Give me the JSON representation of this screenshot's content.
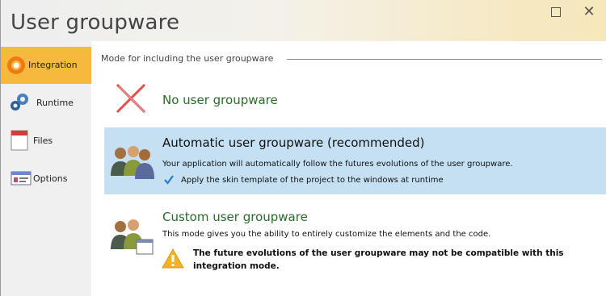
{
  "window": {
    "title": "User groupware",
    "maximize_icon": "maximize-icon",
    "close_icon": "close-icon"
  },
  "sidebar": {
    "items": [
      {
        "label": "Integration",
        "icon": "integration-icon",
        "active": true
      },
      {
        "label": "Runtime",
        "icon": "gears-icon",
        "active": false
      },
      {
        "label": "Files",
        "icon": "file-icon",
        "active": false
      },
      {
        "label": "Options",
        "icon": "options-icon",
        "active": false
      }
    ]
  },
  "content": {
    "section_title": "Mode for including the user groupware",
    "options": [
      {
        "title": "No user groupware",
        "icon": "red-x-icon",
        "selected": false
      },
      {
        "title": "Automatic user groupware (recommended)",
        "description": "Your application will automatically follow the futures evolutions of the user groupware.",
        "checkbox_label": "Apply the skin template of the project to the windows at runtime",
        "checkbox_checked": true,
        "icon": "users-icon",
        "selected": true
      },
      {
        "title": "Custom user groupware",
        "description": "This mode gives you the ability to entirely customize the elements and the code.",
        "warning": "The future evolutions of the user groupware may not be compatible with this integration mode.",
        "icon": "users-custom-icon",
        "warning_icon": "warning-icon",
        "selected": false
      }
    ]
  },
  "colors": {
    "active_tab": "#f7b93d",
    "selected_option": "#c4e0f2",
    "title_green": "#2a6b2a"
  }
}
